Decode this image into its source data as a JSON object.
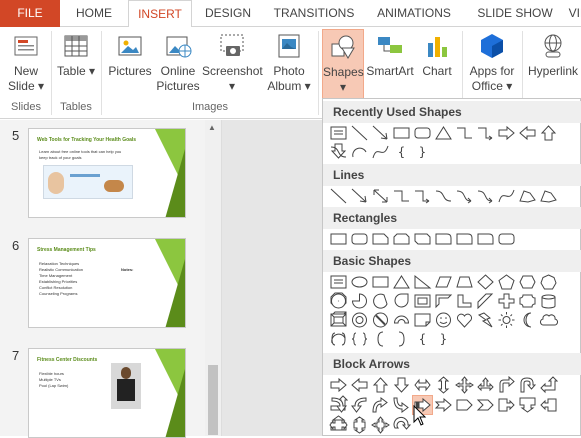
{
  "tabs": [
    "FILE",
    "HOME",
    "INSERT",
    "DESIGN",
    "TRANSITIONS",
    "ANIMATIONS",
    "SLIDE SHOW",
    "VIEW"
  ],
  "ribbon": {
    "new_slide": {
      "line1": "New",
      "line2": "Slide ▾"
    },
    "table": "Table ▾",
    "pictures": "Pictures",
    "online_pictures": {
      "line1": "Online",
      "line2": "Pictures"
    },
    "screenshot": {
      "line1": "Screenshot",
      "line2": "▾"
    },
    "photo_album": {
      "line1": "Photo",
      "line2": "Album ▾"
    },
    "shapes": {
      "line1": "Shapes",
      "line2": "▾"
    },
    "smartart": "SmartArt",
    "chart": "Chart",
    "apps": {
      "line1": "Apps for",
      "line2": "Office ▾"
    },
    "hyperlink": "Hyperlink",
    "groups": {
      "slides": "Slides",
      "tables": "Tables",
      "images": "Images"
    }
  },
  "slides": [
    {
      "number": "5",
      "title": "Web Tools for Tracking Your Health Goals",
      "bullets": [
        "Learn about free online tools that can help you",
        "keep track of your goals"
      ]
    },
    {
      "number": "6",
      "title": "Stress Management Tips",
      "bullets": [
        "Relaxation Techniques",
        "Realistic Communication",
        "Time Management",
        "Establishing Priorities",
        "Conflict Resolution",
        "Counseling Programs"
      ],
      "side_label": "Notes:"
    },
    {
      "number": "7",
      "title": "Fitness Center Discounts",
      "bullets": [
        "Flexible hours",
        "Multiple TVs",
        "Pool (Lap Swim)"
      ]
    }
  ],
  "shapes_panel": {
    "sections": [
      "Recently Used Shapes",
      "Lines",
      "Rectangles",
      "Basic Shapes",
      "Block Arrows"
    ],
    "recent_text_shapes": [
      "{",
      "}"
    ],
    "basic_text_shapes": [
      "{",
      "}"
    ]
  },
  "colors": {
    "accent": "#d24726",
    "highlight": "#f7c9b5",
    "slide_green": "#8cc63f"
  }
}
